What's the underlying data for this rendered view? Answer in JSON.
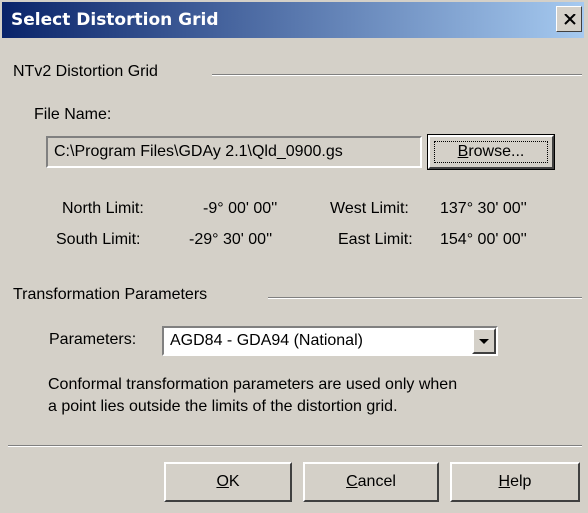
{
  "dialog": {
    "title": "Select Distortion Grid",
    "close_icon": "close-icon"
  },
  "grid_group": {
    "label": "NTv2 Distortion Grid",
    "file_name_label": "File Name:",
    "file_name_value": "C:\\Program Files\\GDAy 2.1\\Qld_0900.gs",
    "browse_label_pre": "",
    "browse_label_u": "B",
    "browse_label_post": "rowse...",
    "north_limit_label": "North Limit:",
    "north_limit_value": "-9° 00' 00''",
    "west_limit_label": "West Limit:",
    "west_limit_value": "137° 30' 00''",
    "south_limit_label": "South Limit:",
    "south_limit_value": "-29° 30' 00''",
    "east_limit_label": "East Limit:",
    "east_limit_value": "154° 00' 00''"
  },
  "transform_group": {
    "label": "Transformation Parameters",
    "parameters_label": "Parameters:",
    "parameters_value": "AGD84 - GDA94 (National)",
    "dropdown_icon": "chevron-down-icon",
    "note_line1": "Conformal transformation parameters are used only when",
    "note_line2": "a point lies outside the limits of the distortion grid."
  },
  "buttons": {
    "ok_u": "O",
    "ok_post": "K",
    "cancel_u": "C",
    "cancel_post": "ancel",
    "help_u": "H",
    "help_post": "elp"
  }
}
